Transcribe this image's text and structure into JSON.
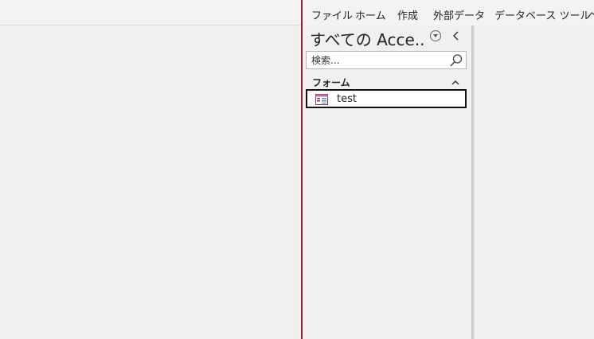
{
  "ribbon": {
    "tabs": [
      {
        "label": "ファイル"
      },
      {
        "label": "ホーム"
      },
      {
        "label": "作成"
      },
      {
        "label": "外部データ"
      },
      {
        "label": "データベース ツール"
      },
      {
        "label": "ヘ"
      }
    ]
  },
  "nav_pane": {
    "title": "すべての Acce...",
    "search": {
      "placeholder": "検索...",
      "value": ""
    },
    "groups": [
      {
        "label": "フォーム",
        "items": [
          {
            "label": "test",
            "icon": "form-icon",
            "selected": true
          }
        ]
      }
    ]
  },
  "colors": {
    "accent_border": "#8c1f2e",
    "background": "#f0f0f0"
  }
}
